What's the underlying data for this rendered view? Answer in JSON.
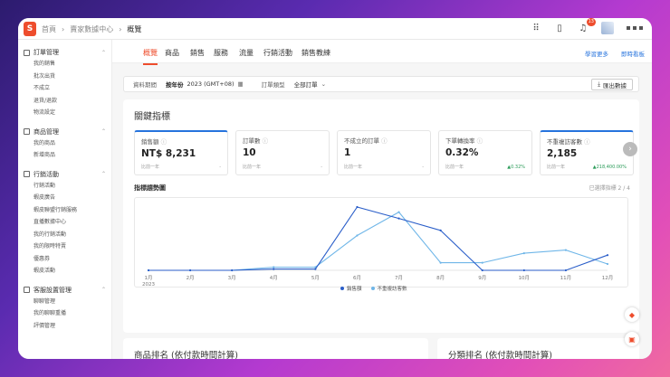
{
  "topbar": {
    "logo": "S",
    "breadcrumb": [
      "首頁",
      "賣家數據中心",
      "概覽"
    ],
    "notif_count": "13"
  },
  "sidebar": [
    {
      "title": "訂單管理",
      "items": [
        "我的銷售",
        "批次出貨",
        "不成立",
        "退貨/退款",
        "物流設定"
      ]
    },
    {
      "title": "商品管理",
      "items": [
        "我的商品",
        "新增商品"
      ]
    },
    {
      "title": "行銷活動",
      "items": [
        "行銷活動",
        "蝦皮廣告",
        "蝦皮聯盟行銷服務",
        "直播數據中心",
        "我的行銷活動",
        "我的限時特賣",
        "優惠券",
        "蝦皮活動"
      ]
    },
    {
      "title": "客服設置管理",
      "items": [
        "聊聊管理",
        "我的聊聊重播",
        "評價管理"
      ]
    }
  ],
  "tabs": [
    "概覽",
    "商品",
    "銷售",
    "服務",
    "流量",
    "行銷活動",
    "銷售教練"
  ],
  "tab_links": [
    "學習更多",
    "即時看板"
  ],
  "filter": {
    "period_label": "資料期間",
    "period_type": "按年份",
    "period_value": "2023 (GMT+08)",
    "order_type_label": "訂單類型",
    "order_type_value": "全部訂單",
    "export": "匯出數據"
  },
  "key_metrics_title": "關鍵指標",
  "kpis": [
    {
      "label": "銷售額",
      "value": "NT$ 8,231",
      "compare": "比前一年",
      "change": "-"
    },
    {
      "label": "訂單數",
      "value": "10",
      "compare": "比前一年",
      "change": "-"
    },
    {
      "label": "不成立的訂單",
      "value": "1",
      "compare": "比前一年",
      "change": "-"
    },
    {
      "label": "下單轉換率",
      "value": "0.32%",
      "compare": "比前一年",
      "change": "▲0.32%"
    },
    {
      "label": "不重複訪客數",
      "value": "2,185",
      "compare": "比前一年",
      "change": "▲218,400.00%"
    }
  ],
  "trend_title": "指標趨勢圖",
  "trend_selected": "已選擇指標 2 / 4",
  "chart_data": {
    "type": "line",
    "categories": [
      "1月",
      "2月",
      "3月",
      "4月",
      "5月",
      "6月",
      "7月",
      "8月",
      "9月",
      "10月",
      "11月",
      "12月"
    ],
    "year_label": "2023",
    "colors": [
      "#2a5ec9",
      "#6fb6e8"
    ],
    "series": [
      {
        "name": "銷售額",
        "values": [
          0,
          0,
          0,
          0.02,
          0.02,
          1.0,
          0.82,
          0.63,
          0,
          0,
          0,
          0.24
        ]
      },
      {
        "name": "不重複訪客數",
        "values": [
          0,
          0,
          0,
          0.05,
          0.05,
          0.55,
          0.92,
          0.12,
          0.12,
          0.27,
          0.32,
          0.1
        ]
      }
    ]
  },
  "product_rank_title": "商品排名 (依付款時間計算)",
  "category_rank_title": "分類排名 (依付款時間計算)"
}
